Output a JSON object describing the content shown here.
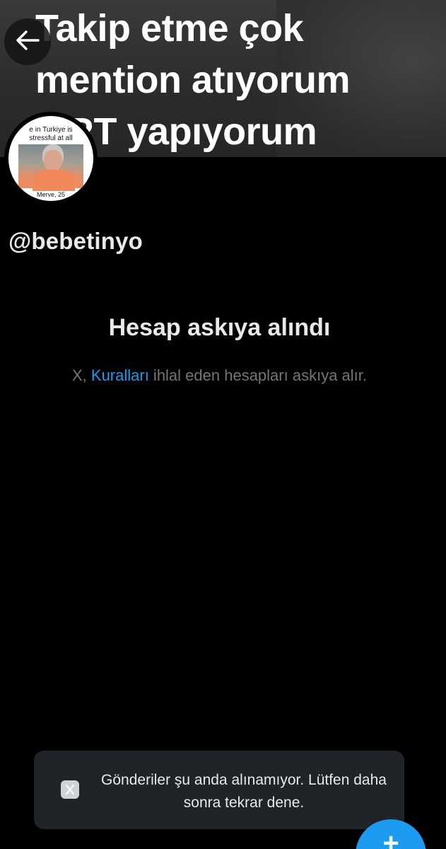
{
  "banner": {
    "lines": [
      "Takip etme çok",
      "mention atıyorum",
      "k RT yapıyorum"
    ]
  },
  "nav": {
    "back_icon": "arrow-left-icon"
  },
  "avatar": {
    "caption_top": "e in Turkiye is\nstressful at all",
    "caption_bottom": "Merve, 25"
  },
  "profile": {
    "handle": "@bebetinyo"
  },
  "suspension": {
    "title": "Hesap askıya alındı",
    "desc_prefix": "X, ",
    "desc_link": "Kuralları",
    "desc_suffix": " ihlal eden hesapları askıya alır."
  },
  "toast": {
    "icon": "x-logo-icon",
    "message": "Gönderiler şu anda alınamıyor. Lütfen daha sonra tekrar dene."
  },
  "fab": {
    "label": "+",
    "icon": "compose-plus-icon"
  },
  "colors": {
    "background": "#000000",
    "text_primary": "#e7e9ea",
    "text_secondary": "#71767b",
    "link": "#1d9bf0",
    "toast_bg": "#202327"
  }
}
